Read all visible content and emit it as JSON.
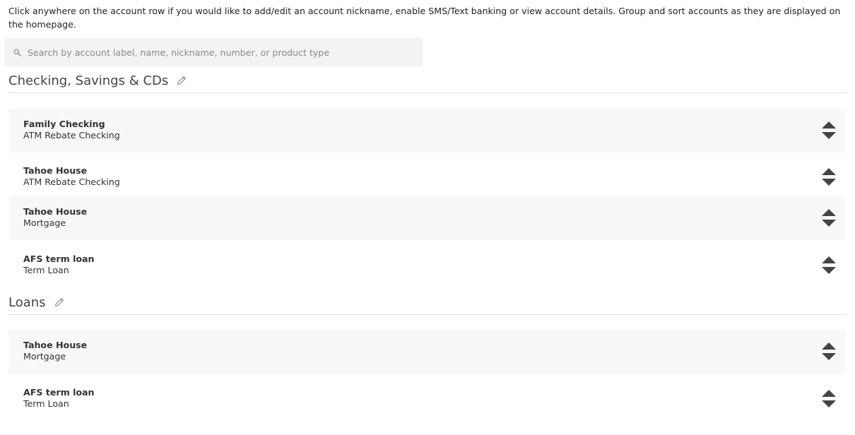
{
  "intro": {
    "text": "Click anywhere on the account row if you would like to add/edit an account nickname, enable SMS/Text banking or view account details. Group and sort accounts as they are displayed on the homepage."
  },
  "search": {
    "placeholder": "Search by account label, name, nickname, number, or product type",
    "icon": "search-icon"
  },
  "groups": [
    {
      "title": "Checking, Savings & CDs",
      "rows": [
        {
          "name": "Family Checking",
          "type": "ATM Rebate Checking"
        },
        {
          "name": "Tahoe House",
          "type": "ATM Rebate Checking"
        },
        {
          "name": "Tahoe House",
          "type": "Mortgage"
        },
        {
          "name": "AFS term loan",
          "type": "Term Loan"
        }
      ]
    },
    {
      "title": "Loans",
      "rows": [
        {
          "name": "Tahoe House",
          "type": "Mortgage"
        },
        {
          "name": "AFS term loan",
          "type": "Term Loan"
        }
      ]
    }
  ],
  "colors": {
    "row_shaded": "#f8f8f8",
    "search_bg": "#f3f3f3",
    "arrow": "#444444"
  }
}
